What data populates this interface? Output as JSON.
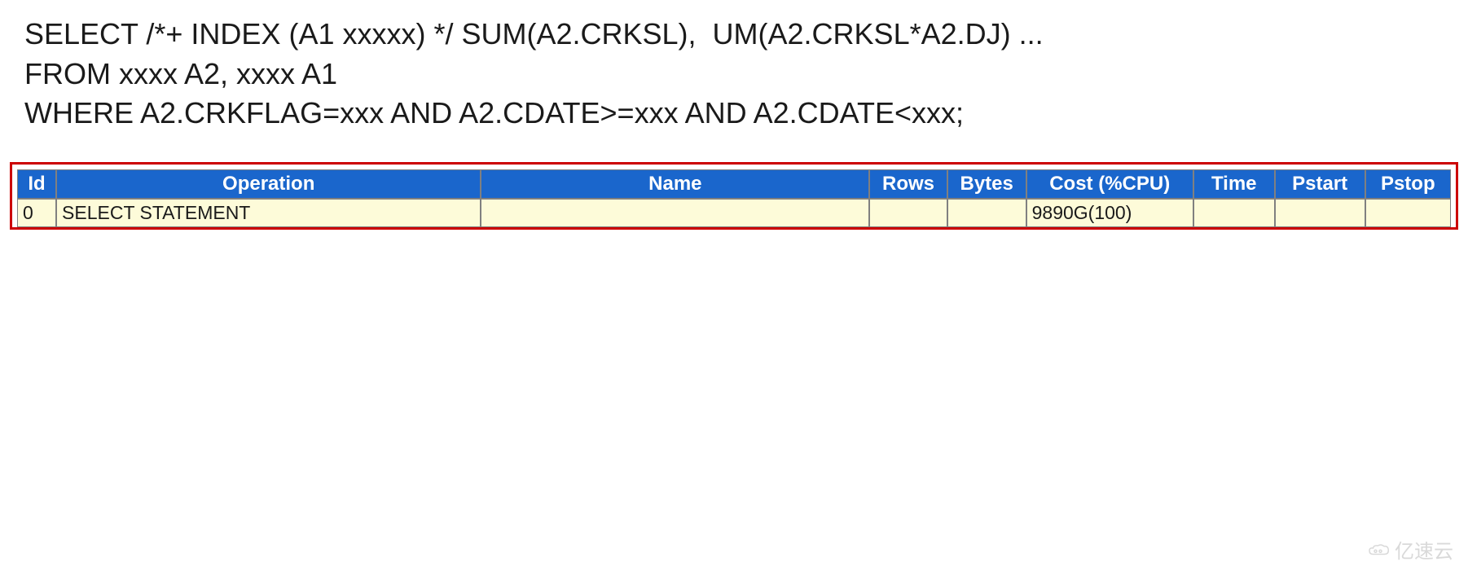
{
  "sql": {
    "line1": "SELECT /*+ INDEX (A1 xxxxx) */ SUM(A2.CRKSL),  UM(A2.CRKSL*A2.DJ) ...",
    "line2": "FROM xxxx A2, xxxx A1",
    "line3": "WHERE A2.CRKFLAG=xxx AND A2.CDATE>=xxx AND A2.CDATE<xxx;"
  },
  "plan": {
    "headers": {
      "id": "Id",
      "operation": "Operation",
      "name": "Name",
      "rows": "Rows",
      "bytes": "Bytes",
      "cost": "Cost (%CPU)",
      "time": "Time",
      "pstart": "Pstart",
      "pstop": "Pstop"
    },
    "rows": [
      {
        "id": "0",
        "operation": "SELECT STATEMENT",
        "name": "",
        "rows": "",
        "bytes": "",
        "cost": "9890G(100)",
        "time": "",
        "pstart": "",
        "pstop": ""
      }
    ]
  },
  "watermark": {
    "text": "亿速云"
  }
}
